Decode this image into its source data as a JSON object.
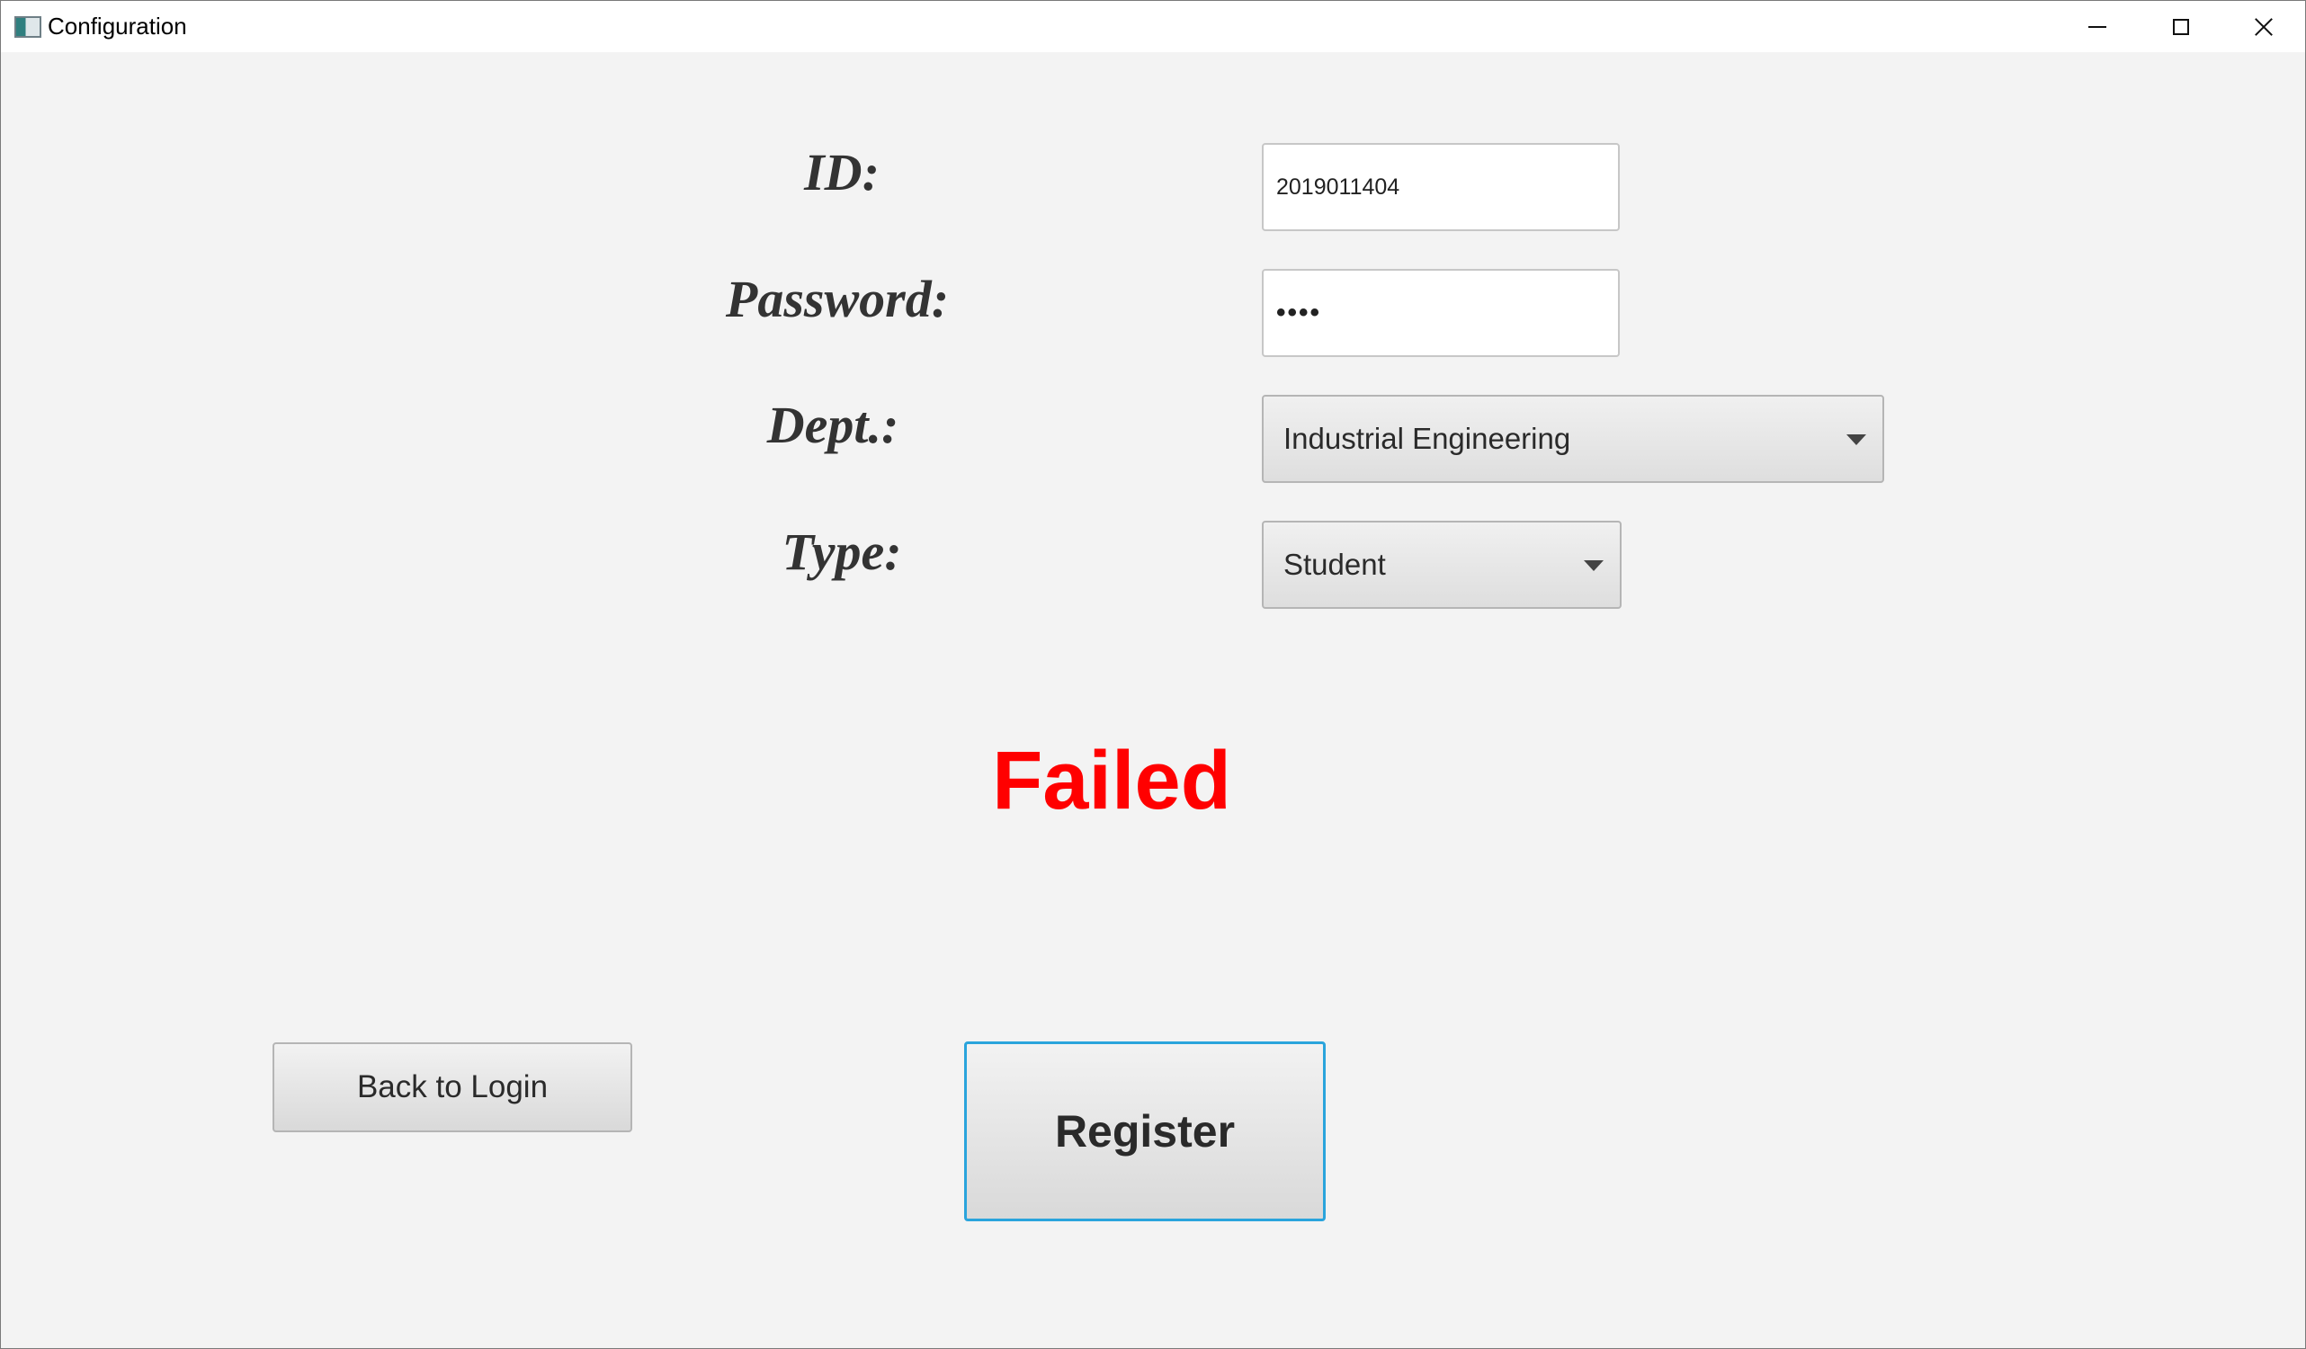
{
  "window": {
    "title": "Configuration",
    "icon": "app-window-icon"
  },
  "form": {
    "id_label": "ID:",
    "id_value": "2019011404",
    "password_label": "Password:",
    "password_value": "••••",
    "dept_label": "Dept.:",
    "dept_selected": "Industrial Engineering",
    "type_label": "Type:",
    "type_selected": "Student"
  },
  "status": {
    "text": "Failed",
    "color": "#ff0000"
  },
  "buttons": {
    "back_label": "Back to Login",
    "register_label": "Register"
  },
  "colors": {
    "focus_border": "#2aa4dc",
    "background": "#f3f3f3"
  }
}
